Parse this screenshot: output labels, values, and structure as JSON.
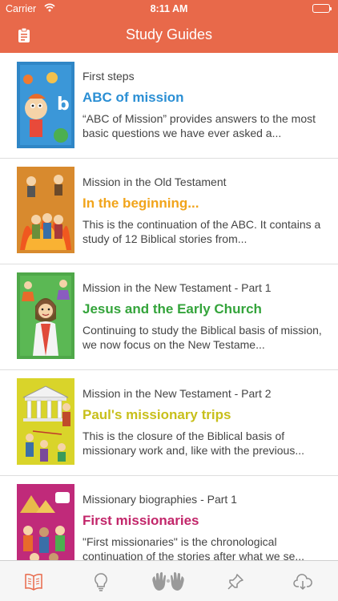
{
  "status_bar": {
    "carrier": "Carrier",
    "time": "8:11 AM"
  },
  "nav": {
    "title": "Study Guides",
    "left_icon": "clipboard-icon"
  },
  "colors": {
    "brand": "#e8694a",
    "tab_active": "#e8694a",
    "tab_inactive": "#8e8e8e"
  },
  "guides": [
    {
      "category": "Mission in the Old Testament",
      "title": "In the beginning...",
      "title_color": "#f1a41b",
      "description": "This is the continuation of the ABC. It contains a study of 12 Biblical stories from...",
      "cover_color": "#d88a2e"
    },
    {
      "category": "Mission in the New Testament - Part 1",
      "title": "Jesus and the Early Church",
      "title_color": "#34a43b",
      "description": "Continuing to study the Biblical basis of mission, we now focus on the New Testame...",
      "cover_color": "#4fa849"
    },
    {
      "category": "Mission in the New Testament - Part 2",
      "title": "Paul's missionary trips",
      "title_color": "#c8bf1a",
      "description": "This is the closure of the Biblical basis of missionary work and, like with the previous...",
      "cover_color": "#d9d42a"
    },
    {
      "category": "Missionary biographies - Part 1",
      "title": "First missionaries",
      "title_color": "#c2266a",
      "description": "\"First missionaries\" is the chronological continuation of the stories after what we se...",
      "cover_color": "#c02a7a"
    }
  ],
  "first_guide": {
    "category": "First steps",
    "title": "ABC of mission",
    "title_color": "#2b8fd4",
    "description": "“ABC of Mission” provides answers to the most basic questions we have ever asked a...",
    "cover_color": "#2f86c6"
  },
  "tabs": [
    {
      "icon": "book-icon",
      "active": true
    },
    {
      "icon": "lightbulb-icon",
      "active": false
    },
    {
      "icon": "hands-icon",
      "active": false
    },
    {
      "icon": "pin-icon",
      "active": false
    },
    {
      "icon": "cloud-download-icon",
      "active": false
    }
  ]
}
